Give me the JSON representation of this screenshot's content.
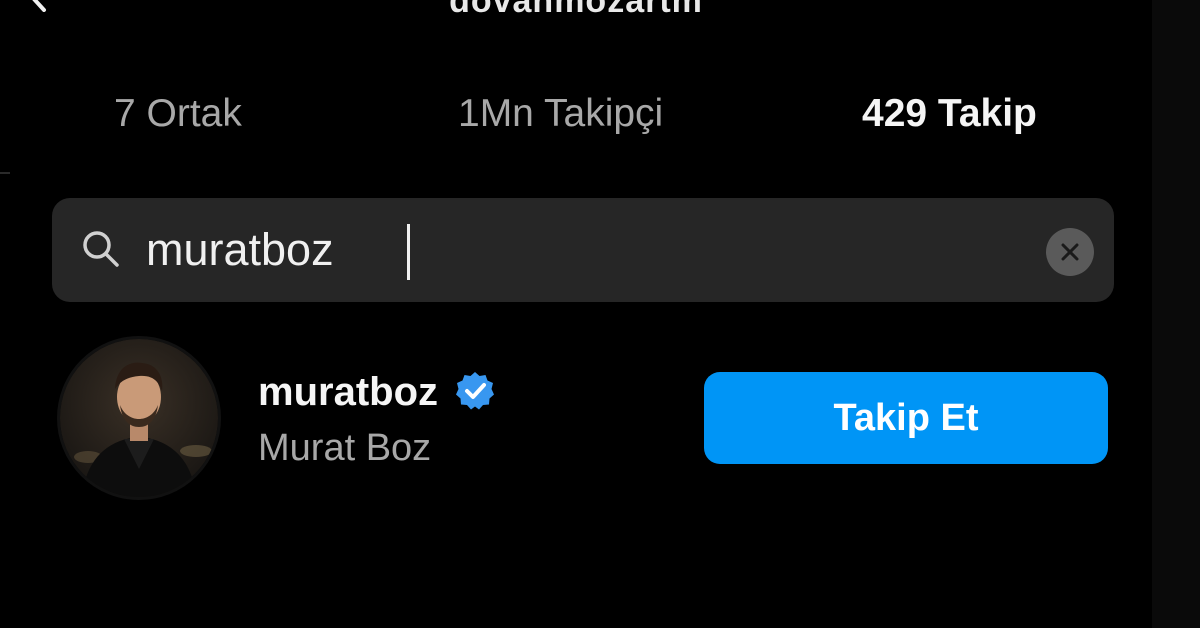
{
  "header": {
    "username_title": "dovanmozartm"
  },
  "tabs": [
    {
      "label": "7 Ortak",
      "active": false
    },
    {
      "label": "1Mn Takipçi",
      "active": false
    },
    {
      "label": "429 Takip",
      "active": true
    }
  ],
  "search": {
    "value": "muratboz",
    "placeholder": ""
  },
  "result": {
    "username": "muratboz",
    "full_name": "Murat Boz",
    "verified": true,
    "follow_label": "Takip Et"
  },
  "icons": {
    "back": "chevron-left-icon",
    "search": "search-icon",
    "clear": "close-circle-icon",
    "verified": "verified-badge-icon"
  },
  "colors": {
    "background": "#000000",
    "search_bg": "#262626",
    "accent": "#0095f6",
    "verified": "#3897f0",
    "secondary_text": "#a8a8a8"
  }
}
